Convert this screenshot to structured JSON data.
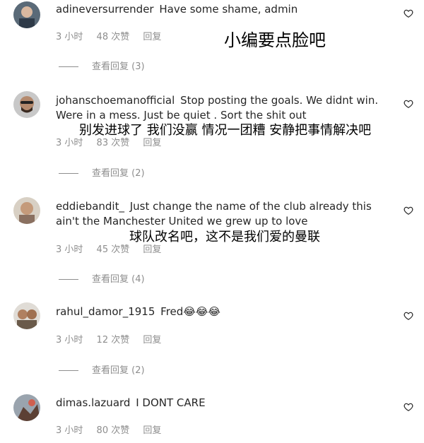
{
  "comments": [
    {
      "username": "adineversurrender",
      "text": "Have some shame, admin",
      "time": "3 小时",
      "likes": "48 次赞",
      "reply_label": "回复",
      "view_replies": "查看回复 (3)",
      "translation": "小编要点脸吧"
    },
    {
      "username": "johanschoemanofficial",
      "text": "Stop posting the goals. We didnt win. Were in a mess. Just be quiet . Sort the shit out",
      "time": "3 小时",
      "likes": "83 次赞",
      "reply_label": "回复",
      "view_replies": "查看回复 (2)",
      "translation": "别发进球了 我们没赢 情况一团糟 安静把事情解决吧"
    },
    {
      "username": "eddiebandit_",
      "text": "Just change the name of the club already this ain't the Manchester United we grew up to love",
      "time": "3 小时",
      "likes": "45 次赞",
      "reply_label": "回复",
      "view_replies": "查看回复 (4)",
      "translation": "球队改名吧，这不是我们爱的曼联"
    },
    {
      "username": "rahul_damor_1915",
      "text": "Fred😂😂😂",
      "time": "3 小时",
      "likes": "12 次赞",
      "reply_label": "回复",
      "view_replies": "查看回复 (2)"
    },
    {
      "username": "dimas.lazuard",
      "text": "I DONT CARE",
      "time": "3 小时",
      "likes": "80 次赞",
      "reply_label": "回复"
    }
  ],
  "icons": {
    "like": "heart-outline-icon"
  },
  "colors": {
    "text": "#262626",
    "meta": "#8e8e8e"
  }
}
